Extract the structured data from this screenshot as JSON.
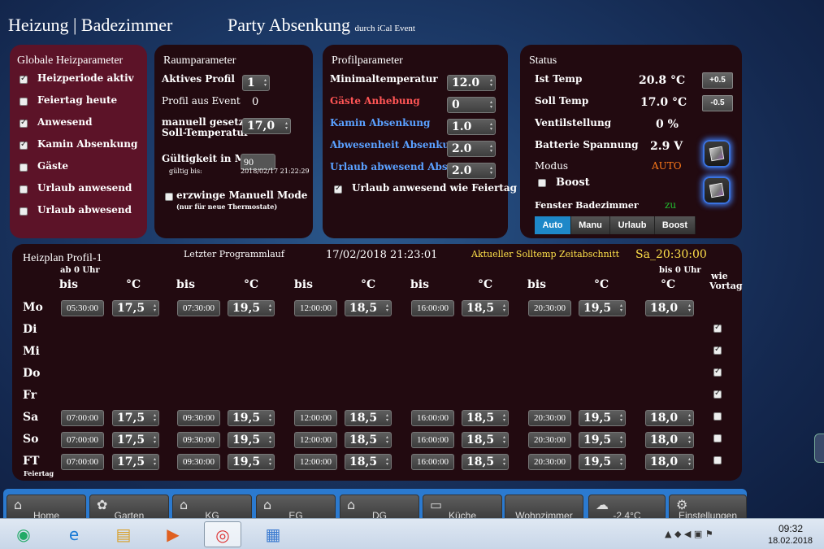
{
  "header": {
    "title": "Heizung | Badezimmer",
    "party": "Party Absenkung",
    "party_sub": "durch iCal Event"
  },
  "global": {
    "title": "Globale Heizparameter",
    "items": [
      {
        "label": "Heizperiode aktiv",
        "checked": true
      },
      {
        "label": "Feiertag heute",
        "checked": false
      },
      {
        "label": "Anwesend",
        "checked": true
      },
      {
        "label": "Kamin Absenkung",
        "checked": true
      },
      {
        "label": "Gäste",
        "checked": false
      },
      {
        "label": "Urlaub anwesend",
        "checked": false
      },
      {
        "label": "Urlaub abwesend",
        "checked": false
      }
    ]
  },
  "room": {
    "title": "Raumparameter",
    "profile_label": "Aktives Profil",
    "profile_value": "1",
    "event_label": "Profil aus Event",
    "event_value": "0",
    "manual_label1": "manuell gesetzte",
    "manual_label2": "Soll-Temperatur",
    "manual_value": "17,0",
    "valid_label": "Gültigkeit in Min",
    "valid_value": "90",
    "valid_until_label": "gültig bis:",
    "valid_until_value": "2018/02/17 21:22:29",
    "force_label": "erzwinge Manuell Mode",
    "force_sub": "(nur für neue Thermostate)"
  },
  "profile": {
    "title": "Profilparameter",
    "rows": [
      {
        "label": "Minimaltemperatur",
        "value": "12.0",
        "color": "#ffffff"
      },
      {
        "label": "Gäste Anhebung",
        "value": "0",
        "color": "#ff5555"
      },
      {
        "label": "Kamin Absenkung",
        "value": "1.0",
        "color": "#5aa0ff"
      },
      {
        "label": "Abwesenheit Absenkung",
        "value": "2.0",
        "color": "#5aa0ff"
      },
      {
        "label": "Urlaub abwesend Abs.",
        "value": "2.0",
        "color": "#5aa0ff"
      }
    ],
    "holiday_label": "Urlaub anwesend wie Feiertag"
  },
  "status": {
    "title": "Status",
    "ist_label": "Ist Temp",
    "ist_value": "20.8 °C",
    "soll_label": "Soll Temp",
    "soll_value": "17.0 °C",
    "plus": "+0.5",
    "minus": "-0.5",
    "valve_label": "Ventilstellung",
    "valve_value": "0 %",
    "battery_label": "Batterie Spannung",
    "battery_value": "2.9 V",
    "mode_label": "Modus",
    "mode_value": "AUTO",
    "boost_label": "Boost",
    "window_label": "Fenster Badezimmer",
    "window_value": "zu",
    "modes": [
      "Auto",
      "Manu",
      "Urlaub",
      "Boost"
    ],
    "mode_color": "#ff7a1a",
    "window_color": "#22c030"
  },
  "schedule": {
    "title": "Heizplan Profil-1",
    "last_run_label": "Letzter Programmlauf",
    "last_run_value": "17/02/2018 21:23:01",
    "current_label": "Aktueller Solltemp Zeitabschnitt",
    "current_value": "Sa_20:30:00",
    "from_label": "ab 0 Uhr",
    "to_label": "bis 0 Uhr",
    "bis": "bis",
    "deg": "°C",
    "prev_label1": "wie",
    "prev_label2": "Vortag",
    "ft_sub": "Feiertag",
    "days": [
      {
        "day": "Mo",
        "times": [
          "05:30:00",
          "07:30:00",
          "12:00:00",
          "16:00:00",
          "20:30:00"
        ],
        "temps": [
          "17,5",
          "19,5",
          "18,5",
          "18,5",
          "19,5",
          "18,0"
        ],
        "prev": null
      },
      {
        "day": "Di",
        "times": [],
        "temps": [],
        "prev": true
      },
      {
        "day": "Mi",
        "times": [],
        "temps": [],
        "prev": true
      },
      {
        "day": "Do",
        "times": [],
        "temps": [],
        "prev": true
      },
      {
        "day": "Fr",
        "times": [],
        "temps": [],
        "prev": true
      },
      {
        "day": "Sa",
        "times": [
          "07:00:00",
          "09:30:00",
          "12:00:00",
          "16:00:00",
          "20:30:00"
        ],
        "temps": [
          "17,5",
          "19,5",
          "18,5",
          "18,5",
          "19,5",
          "18,0"
        ],
        "prev": false
      },
      {
        "day": "So",
        "times": [
          "07:00:00",
          "09:30:00",
          "12:00:00",
          "16:00:00",
          "20:30:00"
        ],
        "temps": [
          "17,5",
          "19,5",
          "18,5",
          "18,5",
          "19,5",
          "18,0"
        ],
        "prev": false
      },
      {
        "day": "FT",
        "times": [
          "07:00:00",
          "09:30:00",
          "12:00:00",
          "16:00:00",
          "20:30:00"
        ],
        "temps": [
          "17,5",
          "19,5",
          "18,5",
          "18,5",
          "19,5",
          "18,0"
        ],
        "prev": false
      }
    ]
  },
  "nav": [
    {
      "label": "Home",
      "icon": "home-icon"
    },
    {
      "label": "Garten",
      "icon": "garden-icon"
    },
    {
      "label": "KG",
      "icon": "house-icon"
    },
    {
      "label": "EG",
      "icon": "house-icon"
    },
    {
      "label": "DG",
      "icon": "house-icon"
    },
    {
      "label": "Küche",
      "icon": "kitchen-icon"
    },
    {
      "label": "Wohnzimmer",
      "icon": ""
    },
    {
      "label": "-2.4°C",
      "icon": "weather-icon"
    },
    {
      "label": "Einstellungen",
      "icon": "gear-icon"
    }
  ],
  "taskbar": {
    "time": "09:32",
    "date": "18.02.2018",
    "apps": [
      "start-icon",
      "ie-icon",
      "explorer-icon",
      "media-icon",
      "chrome-icon",
      "app-icon"
    ]
  }
}
